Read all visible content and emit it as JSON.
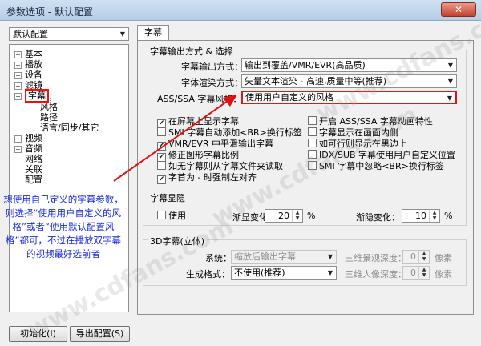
{
  "window": {
    "title": "参数选项 - 默认配置",
    "close": "✕"
  },
  "profile": {
    "value": "默认配置"
  },
  "tree": {
    "items": [
      {
        "label": "基本",
        "exp": "+"
      },
      {
        "label": "播放",
        "exp": "+"
      },
      {
        "label": "设备",
        "exp": "+"
      },
      {
        "label": "滤镜",
        "exp": "+"
      },
      {
        "label": "字幕",
        "exp": "−"
      },
      {
        "label": "风格"
      },
      {
        "label": "路径"
      },
      {
        "label": "语言/同步/其它"
      },
      {
        "label": "视频",
        "exp": "+"
      },
      {
        "label": "音频",
        "exp": "+"
      },
      {
        "label": "网络"
      },
      {
        "label": "关联"
      },
      {
        "label": "配置"
      }
    ]
  },
  "annotation": "想使用自己定义的字幕参数，则选择“使用用户自定义的风格”或者“使用默认配置风格”都可，不过在播放双字幕的视频最好选前者",
  "buttons": {
    "init": "初始化(I)",
    "export": "导出配置(S)"
  },
  "tab": {
    "label": "字幕"
  },
  "output": {
    "title": "字幕输出方式 & 选择",
    "mode_label": "字幕输出方式：",
    "mode_value": "输出到覆盖/VMR/EVR(高品质)",
    "render_label": "字体渲染方式：",
    "render_value": "矢量文本渲染 - 高速,质量中等(推荐)",
    "style_label": "ASS/SSA 字幕风格：",
    "style_value": "使用用户自定义的风格"
  },
  "checks_left": [
    {
      "label": "在屏幕上显示字幕",
      "checked": true
    },
    {
      "label": "SMI 字幕自动添加<BR>换行标签",
      "checked": false
    },
    {
      "label": "VMR/EVR 中平滑输出字幕",
      "checked": true
    },
    {
      "label": "修正图形字幕比例",
      "checked": true
    },
    {
      "label": "如无字幕则从字幕文件夹读取",
      "checked": false
    },
    {
      "label": "字首为 - 时强制左对齐",
      "checked": true
    }
  ],
  "checks_right": [
    {
      "label": "开启 ASS/SSA 字幕动画特性",
      "checked": false
    },
    {
      "label": "字幕显示在画面内侧",
      "checked": false
    },
    {
      "label": "如可行则显示在黑边上",
      "checked": false
    },
    {
      "label": "IDX/SUB 字幕使用用户自定义位置",
      "checked": false
    },
    {
      "label": "SMI 字幕中忽略<BR>换行标签",
      "checked": false
    }
  ],
  "fade": {
    "title": "字幕显隐",
    "use_label": "使用",
    "fadein_label": "渐显变化：",
    "fadein_value": "20",
    "fadeout_label": "渐隐变化：",
    "fadeout_value": "10",
    "unit": "%"
  },
  "three_d": {
    "title": "3D字幕(立体)",
    "system_label": "系统：",
    "system_value": "缩放后输出字幕",
    "format_label": "生成格式：",
    "format_value": "不使用(推荐)",
    "depth1_label": "三维景观深度：",
    "depth1_value": "0",
    "depth2_label": "三维人像深度：",
    "depth2_value": "0",
    "px": "像素"
  },
  "watermark": "www.cdfans.com",
  "colors": {
    "annotation": "#1a2cdc",
    "highlight": "#e11111"
  }
}
